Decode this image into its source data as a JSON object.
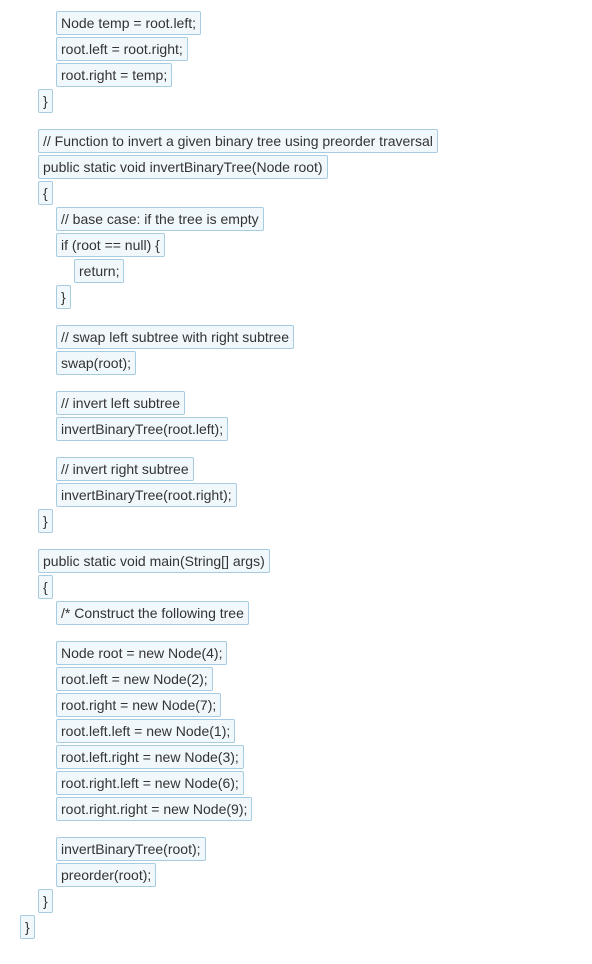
{
  "blocks": [
    {
      "lines": [
        {
          "indent": 2,
          "text": "Node temp = root.left;"
        },
        {
          "indent": 2,
          "text": "root.left = root.right;"
        },
        {
          "indent": 2,
          "text": "root.right = temp;"
        },
        {
          "indent": 1,
          "text": "}"
        }
      ]
    },
    {
      "lines": [
        {
          "indent": 1,
          "text": "// Function to invert a given binary tree using preorder traversal"
        },
        {
          "indent": 1,
          "text": "public static void invertBinaryTree(Node root)"
        },
        {
          "indent": 1,
          "text": "{"
        },
        {
          "indent": 2,
          "text": "// base case: if the tree is empty"
        },
        {
          "indent": 2,
          "text": "if (root == null) {"
        },
        {
          "indent": 3,
          "text": "return;"
        },
        {
          "indent": 2,
          "text": "}"
        }
      ]
    },
    {
      "lines": [
        {
          "indent": 2,
          "text": "// swap left subtree with right subtree"
        },
        {
          "indent": 2,
          "text": "swap(root);"
        }
      ]
    },
    {
      "lines": [
        {
          "indent": 2,
          "text": "// invert left subtree"
        },
        {
          "indent": 2,
          "text": "invertBinaryTree(root.left);"
        }
      ]
    },
    {
      "lines": [
        {
          "indent": 2,
          "text": "// invert right subtree"
        },
        {
          "indent": 2,
          "text": "invertBinaryTree(root.right);"
        },
        {
          "indent": 1,
          "text": "}"
        }
      ]
    },
    {
      "lines": [
        {
          "indent": 1,
          "text": "public static void main(String[] args)"
        },
        {
          "indent": 1,
          "text": "{"
        },
        {
          "indent": 2,
          "text": "/* Construct the following tree"
        }
      ]
    },
    {
      "lines": [
        {
          "indent": 2,
          "text": "Node root = new Node(4);"
        },
        {
          "indent": 2,
          "text": "root.left = new Node(2);"
        },
        {
          "indent": 2,
          "text": "root.right = new Node(7);"
        },
        {
          "indent": 2,
          "text": "root.left.left = new Node(1);"
        },
        {
          "indent": 2,
          "text": "root.left.right = new Node(3);"
        },
        {
          "indent": 2,
          "text": "root.right.left = new Node(6);"
        },
        {
          "indent": 2,
          "text": "root.right.right = new Node(9);"
        }
      ]
    },
    {
      "lines": [
        {
          "indent": 2,
          "text": "invertBinaryTree(root);"
        },
        {
          "indent": 2,
          "text": "preorder(root);"
        },
        {
          "indent": 1,
          "text": "}"
        },
        {
          "indent": 0,
          "text": "}"
        }
      ]
    }
  ]
}
